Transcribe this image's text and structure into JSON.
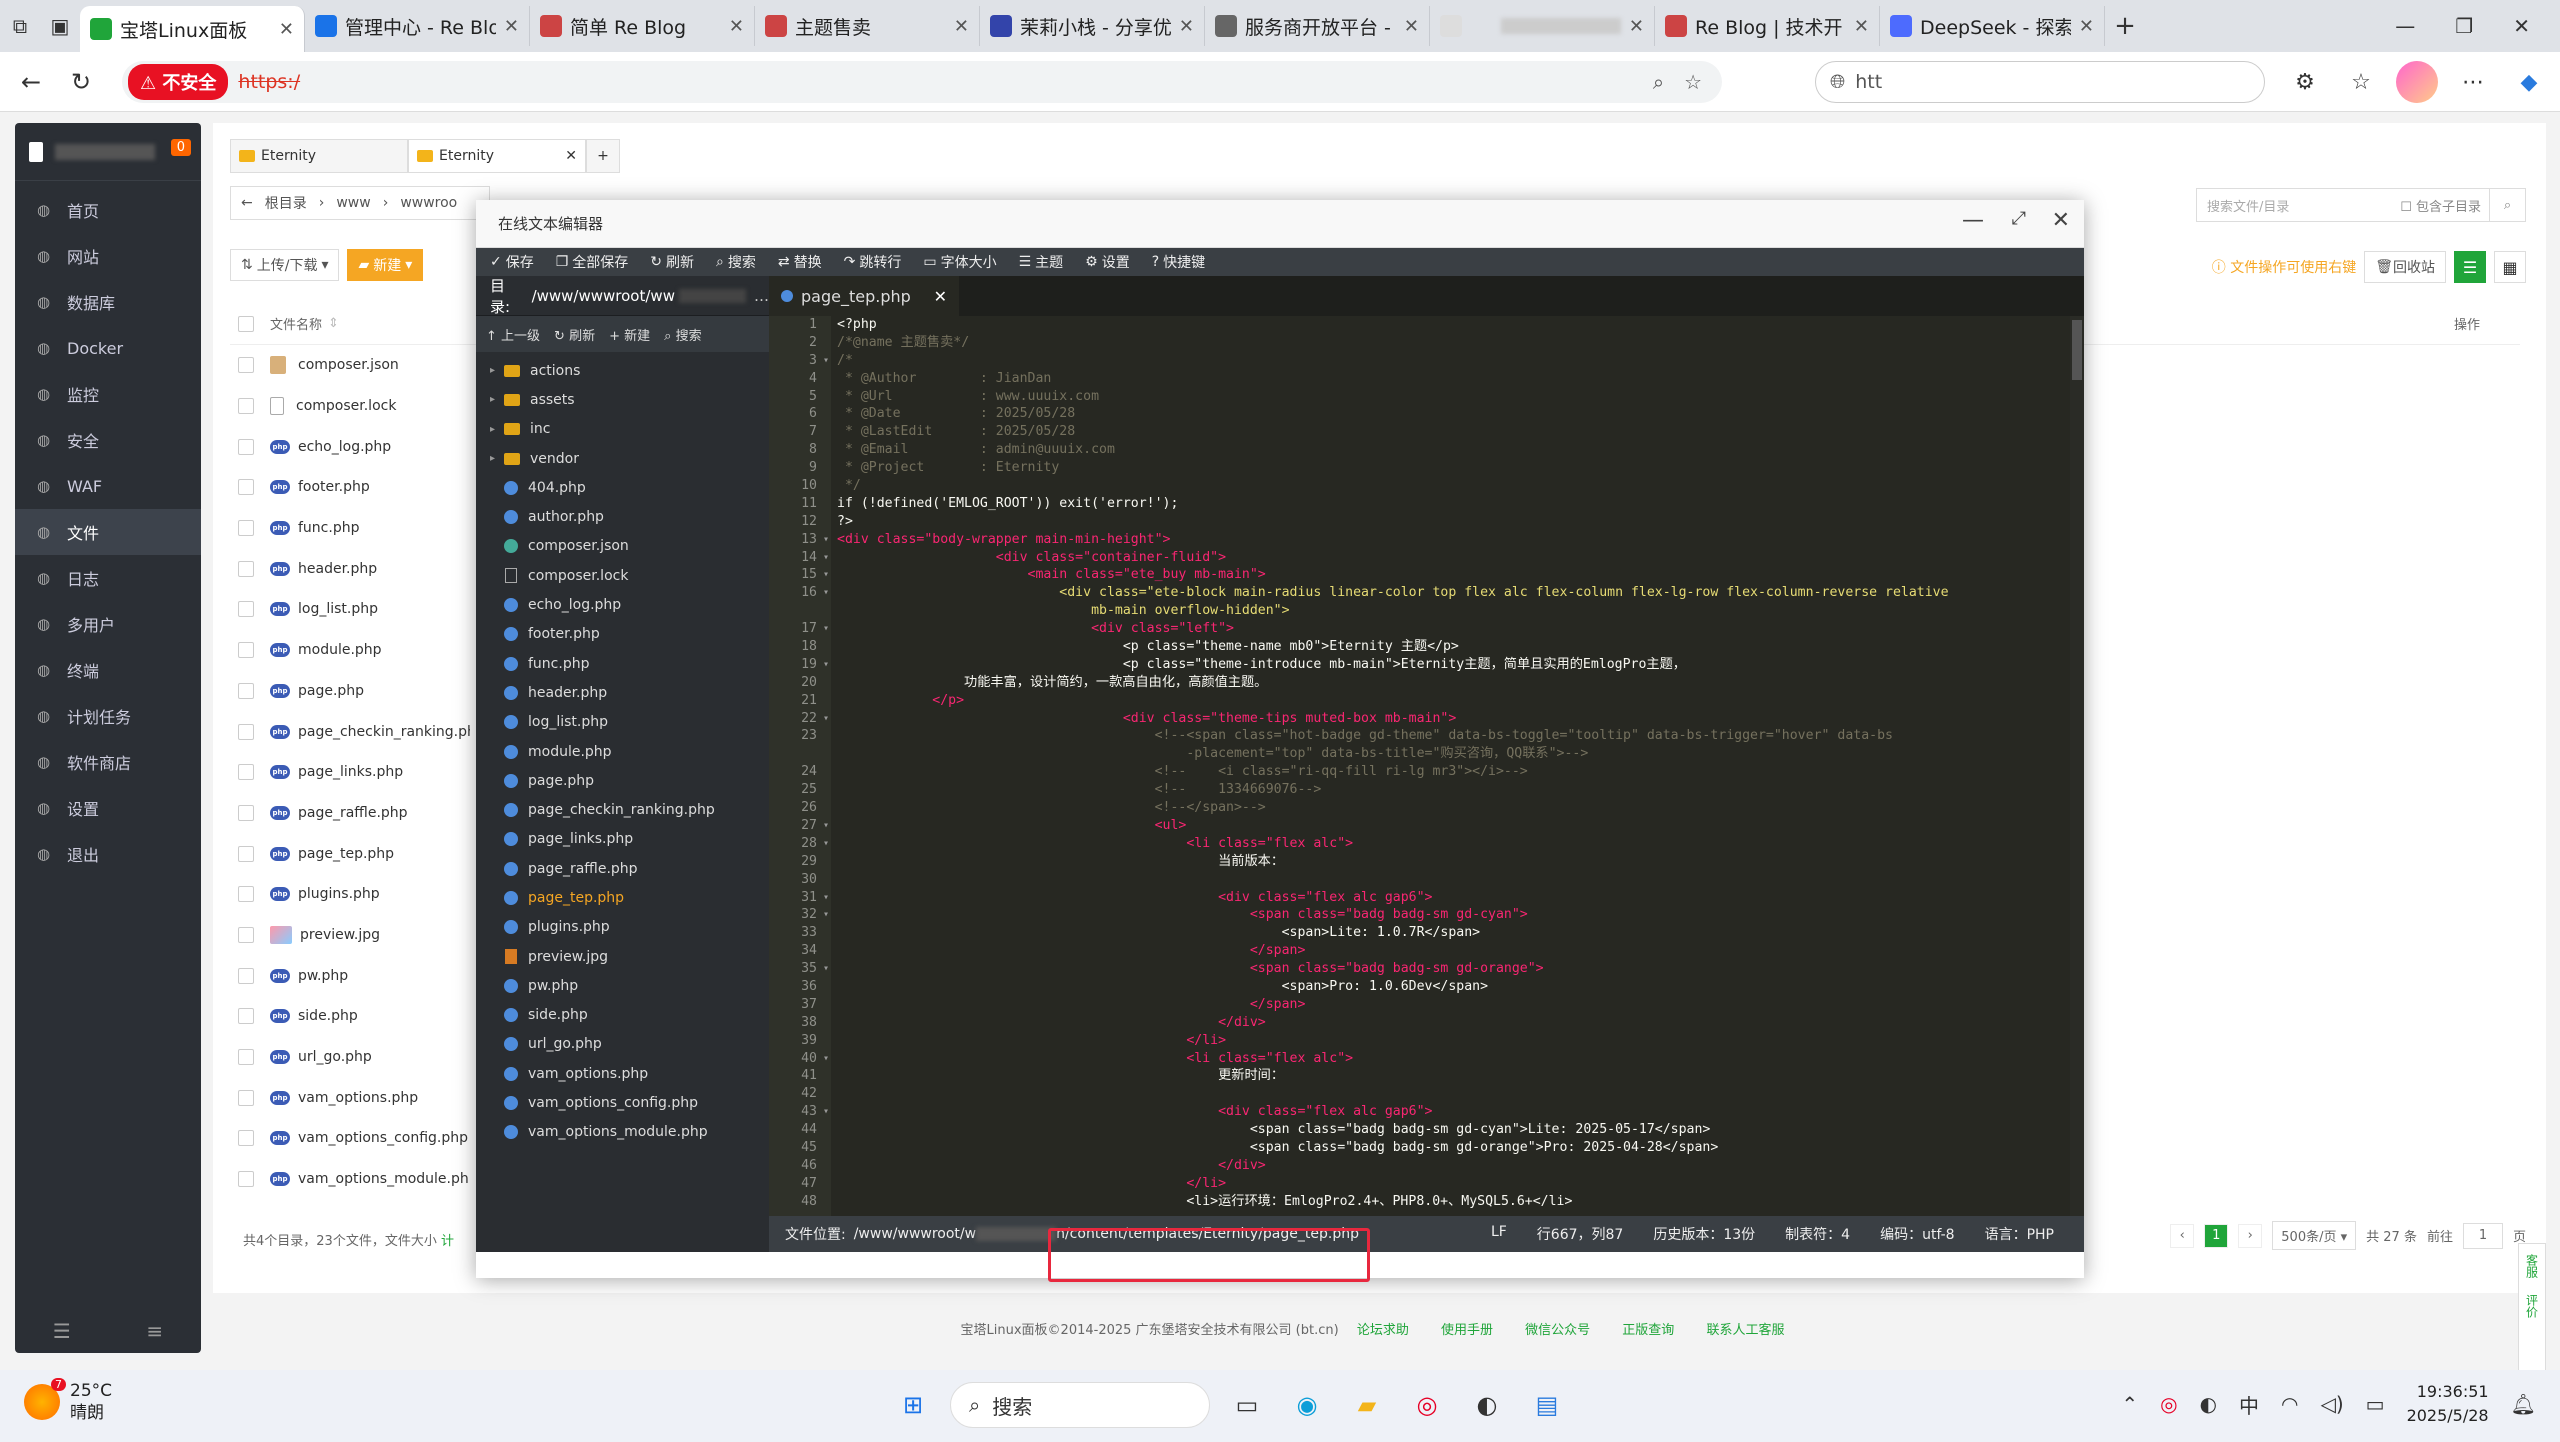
{
  "browser": {
    "tabs": [
      {
        "label": "宝塔Linux面板",
        "color": "#20a53a",
        "active": true
      },
      {
        "label": "管理中心 - Re Blo",
        "color": "#1a73e8"
      },
      {
        "label": "简单 Re Blog",
        "color": "#c44"
      },
      {
        "label": "主题售卖",
        "color": "#c44"
      },
      {
        "label": "茉莉小栈 - 分享优",
        "color": "#3344aa"
      },
      {
        "label": "服务商开放平台 -",
        "color": "#666"
      },
      {
        "label": "",
        "color": "#ddd"
      },
      {
        "label": "Re Blog | 技术开",
        "color": "#c44"
      },
      {
        "label": "DeepSeek - 探索",
        "color": "#4d6bfe"
      }
    ],
    "insecure_label": "不安全",
    "url": "https:/",
    "url2": "htt"
  },
  "sidebar": {
    "badge": "0",
    "items": [
      {
        "label": "首页",
        "icon": "home-icon"
      },
      {
        "label": "网站",
        "icon": "globe-icon"
      },
      {
        "label": "数据库",
        "icon": "database-icon"
      },
      {
        "label": "Docker",
        "icon": "docker-icon"
      },
      {
        "label": "监控",
        "icon": "monitor-icon"
      },
      {
        "label": "安全",
        "icon": "shield-icon"
      },
      {
        "label": "WAF",
        "icon": "waf-icon"
      },
      {
        "label": "文件",
        "icon": "folder-icon",
        "active": true
      },
      {
        "label": "日志",
        "icon": "log-icon"
      },
      {
        "label": "多用户",
        "icon": "users-icon"
      },
      {
        "label": "终端",
        "icon": "terminal-icon"
      },
      {
        "label": "计划任务",
        "icon": "clock-icon"
      },
      {
        "label": "软件商店",
        "icon": "store-icon"
      },
      {
        "label": "设置",
        "icon": "gear-icon"
      },
      {
        "label": "退出",
        "icon": "logout-icon"
      }
    ]
  },
  "files": {
    "tabs": [
      "Eternity",
      "Eternity"
    ],
    "breadcrumb": [
      "根目录",
      "www",
      "wwwroo"
    ],
    "toolbar": {
      "upload": "上传/下载",
      "new": "新建"
    },
    "search_placeholder": "搜索文件/目录",
    "include_sub": "包含子目录",
    "warn": "文件操作可使用右键",
    "recycle": "回收站",
    "col_name": "文件名称",
    "col_op": "操作",
    "rows": [
      {
        "name": "composer.json",
        "type": "json"
      },
      {
        "name": "composer.lock",
        "type": "doc"
      },
      {
        "name": "echo_log.php",
        "type": "php"
      },
      {
        "name": "footer.php",
        "type": "php"
      },
      {
        "name": "func.php",
        "type": "php"
      },
      {
        "name": "header.php",
        "type": "php"
      },
      {
        "name": "log_list.php",
        "type": "php"
      },
      {
        "name": "module.php",
        "type": "php"
      },
      {
        "name": "page.php",
        "type": "php"
      },
      {
        "name": "page_checkin_ranking.php",
        "type": "php"
      },
      {
        "name": "page_links.php",
        "type": "php"
      },
      {
        "name": "page_raffle.php",
        "type": "php"
      },
      {
        "name": "page_tep.php",
        "type": "php"
      },
      {
        "name": "plugins.php",
        "type": "php"
      },
      {
        "name": "preview.jpg",
        "type": "img"
      },
      {
        "name": "pw.php",
        "type": "php"
      },
      {
        "name": "side.php",
        "type": "php"
      },
      {
        "name": "url_go.php",
        "type": "php"
      },
      {
        "name": "vam_options.php",
        "type": "php"
      },
      {
        "name": "vam_options_config.php",
        "type": "php"
      },
      {
        "name": "vam_options_module.php",
        "type": "php"
      }
    ],
    "summary": "共4个目录，23个文件，文件大小",
    "summary_link": "计",
    "pager": {
      "current": "1",
      "per_page": "500条/页",
      "total": "共 27 条",
      "goto": "前往",
      "page_input": "1",
      "page_suffix": "页"
    }
  },
  "copyright": {
    "text": "宝塔Linux面板©2014-2025 广东堡塔安全技术有限公司 (bt.cn)",
    "links": [
      "论坛求助",
      "使用手册",
      "微信公众号",
      "正版查询",
      "联系人工客服"
    ]
  },
  "side_widget": {
    "a": "客服",
    "b": "评价"
  },
  "editor": {
    "title": "在线文本编辑器",
    "toolbar": [
      "保存",
      "全部保存",
      "刷新",
      "搜索",
      "替换",
      "跳转行",
      "字体大小",
      "主题",
      "设置",
      "快捷键"
    ],
    "dir_label": "目录:",
    "dir_path": "/www/wwwroot/ww",
    "tree_buttons": [
      "上一级",
      "刷新",
      "新建",
      "搜索"
    ],
    "tree": [
      {
        "name": "actions",
        "type": "dir"
      },
      {
        "name": "assets",
        "type": "dir"
      },
      {
        "name": "inc",
        "type": "dir"
      },
      {
        "name": "vendor",
        "type": "dir"
      },
      {
        "name": "404.php",
        "type": "php"
      },
      {
        "name": "author.php",
        "type": "php"
      },
      {
        "name": "composer.json",
        "type": "json"
      },
      {
        "name": "composer.lock",
        "type": "doc"
      },
      {
        "name": "echo_log.php",
        "type": "php"
      },
      {
        "name": "footer.php",
        "type": "php"
      },
      {
        "name": "func.php",
        "type": "php"
      },
      {
        "name": "header.php",
        "type": "php"
      },
      {
        "name": "log_list.php",
        "type": "php"
      },
      {
        "name": "module.php",
        "type": "php"
      },
      {
        "name": "page.php",
        "type": "php"
      },
      {
        "name": "page_checkin_ranking.php",
        "type": "php"
      },
      {
        "name": "page_links.php",
        "type": "php"
      },
      {
        "name": "page_raffle.php",
        "type": "php"
      },
      {
        "name": "page_tep.php",
        "type": "php",
        "active": true
      },
      {
        "name": "plugins.php",
        "type": "php"
      },
      {
        "name": "preview.jpg",
        "type": "img"
      },
      {
        "name": "pw.php",
        "type": "php"
      },
      {
        "name": "side.php",
        "type": "php"
      },
      {
        "name": "url_go.php",
        "type": "php"
      },
      {
        "name": "vam_options.php",
        "type": "php"
      },
      {
        "name": "vam_options_config.php",
        "type": "php"
      },
      {
        "name": "vam_options_module.php",
        "type": "php"
      }
    ],
    "open_tab": "page_tep.php",
    "code_lines": [
      {
        "n": "1",
        "t": "<?php",
        "c": "#f8f8f2"
      },
      {
        "n": "2",
        "t": "/*@name 主题售卖*/",
        "c": "#75715e"
      },
      {
        "n": "3",
        "t": "/*",
        "c": "#75715e",
        "f": 1
      },
      {
        "n": "4",
        "t": " * @Author        : JianDan",
        "c": "#75715e"
      },
      {
        "n": "5",
        "t": " * @Url           : www.uuuix.com",
        "c": "#75715e"
      },
      {
        "n": "6",
        "t": " * @Date          : 2025/05/28",
        "c": "#75715e"
      },
      {
        "n": "7",
        "t": " * @LastEdit      : 2025/05/28",
        "c": "#75715e"
      },
      {
        "n": "8",
        "t": " * @Email         : admin@uuuix.com",
        "c": "#75715e"
      },
      {
        "n": "9",
        "t": " * @Project       : Eternity",
        "c": "#75715e"
      },
      {
        "n": "10",
        "t": " */",
        "c": "#75715e"
      },
      {
        "n": "11",
        "t": "if (!defined('EMLOG_ROOT')) exit('error!');",
        "c": "#f8f8f2"
      },
      {
        "n": "12",
        "t": "?>",
        "c": "#f8f8f2"
      },
      {
        "n": "13",
        "t": "<div class=\"body-wrapper main-min-height\">",
        "c": "#f92672",
        "f": 1
      },
      {
        "n": "14",
        "t": "                    <div class=\"container-fluid\">",
        "c": "#f92672",
        "f": 1
      },
      {
        "n": "15",
        "t": "                        <main class=\"ete_buy mb-main\">",
        "c": "#f92672",
        "f": 1
      },
      {
        "n": "16",
        "t": "                            <div class=\"ete-block main-radius linear-color top flex alc flex-column flex-lg-row flex-column-reverse relative",
        "c": "#e6db74",
        "f": 1
      },
      {
        "n": "",
        "t": "                                mb-main overflow-hidden\">",
        "c": "#e6db74"
      },
      {
        "n": "17",
        "t": "                                <div class=\"left\">",
        "c": "#f92672",
        "f": 1
      },
      {
        "n": "18",
        "t": "                                    <p class=\"theme-name mb0\">Eternity 主题</p>",
        "c": "#f8f8f2"
      },
      {
        "n": "19",
        "t": "                                    <p class=\"theme-introduce mb-main\">Eternity主题，简单且实用的EmlogPro主题，",
        "c": "#f8f8f2",
        "f": 1
      },
      {
        "n": "20",
        "t": "                功能丰富，设计简约，一款高自由化，高颜值主题。",
        "c": "#f8f8f2"
      },
      {
        "n": "21",
        "t": "            </p>",
        "c": "#f92672"
      },
      {
        "n": "22",
        "t": "                                    <div class=\"theme-tips muted-box mb-main\">",
        "c": "#f92672",
        "f": 1
      },
      {
        "n": "23",
        "t": "                                        <!--<span class=\"hot-badge gd-theme\" data-bs-toggle=\"tooltip\" data-bs-trigger=\"hover\" data-bs",
        "c": "#75715e"
      },
      {
        "n": "",
        "t": "                                            -placement=\"top\" data-bs-title=\"购买咨询，QQ联系\">-->",
        "c": "#75715e"
      },
      {
        "n": "24",
        "t": "                                        <!--    <i class=\"ri-qq-fill ri-lg mr3\"></i>-->",
        "c": "#75715e"
      },
      {
        "n": "25",
        "t": "                                        <!--    1334669076-->",
        "c": "#75715e"
      },
      {
        "n": "26",
        "t": "                                        <!--</span>-->",
        "c": "#75715e"
      },
      {
        "n": "27",
        "t": "                                        <ul>",
        "c": "#f92672",
        "f": 1
      },
      {
        "n": "28",
        "t": "                                            <li class=\"flex alc\">",
        "c": "#f92672",
        "f": 1
      },
      {
        "n": "29",
        "t": "                                                当前版本：",
        "c": "#f8f8f2"
      },
      {
        "n": "30",
        "t": "",
        "c": "#f8f8f2"
      },
      {
        "n": "31",
        "t": "                                                <div class=\"flex alc gap6\">",
        "c": "#f92672",
        "f": 1
      },
      {
        "n": "32",
        "t": "                                                    <span class=\"badg badg-sm gd-cyan\">",
        "c": "#f92672",
        "f": 1
      },
      {
        "n": "33",
        "t": "                                                        <span>Lite: 1.0.7R</span>",
        "c": "#f8f8f2"
      },
      {
        "n": "34",
        "t": "                                                    </span>",
        "c": "#f92672"
      },
      {
        "n": "35",
        "t": "                                                    <span class=\"badg badg-sm gd-orange\">",
        "c": "#f92672",
        "f": 1
      },
      {
        "n": "36",
        "t": "                                                        <span>Pro: 1.0.6Dev</span>",
        "c": "#f8f8f2"
      },
      {
        "n": "37",
        "t": "                                                    </span>",
        "c": "#f92672"
      },
      {
        "n": "38",
        "t": "                                                </div>",
        "c": "#f92672"
      },
      {
        "n": "39",
        "t": "                                            </li>",
        "c": "#f92672"
      },
      {
        "n": "40",
        "t": "                                            <li class=\"flex alc\">",
        "c": "#f92672",
        "f": 1
      },
      {
        "n": "41",
        "t": "                                                更新时间：",
        "c": "#f8f8f2"
      },
      {
        "n": "42",
        "t": "",
        "c": "#f8f8f2"
      },
      {
        "n": "43",
        "t": "                                                <div class=\"flex alc gap6\">",
        "c": "#f92672",
        "f": 1
      },
      {
        "n": "44",
        "t": "                                                    <span class=\"badg badg-sm gd-cyan\">Lite: 2025-05-17</span>",
        "c": "#f8f8f2"
      },
      {
        "n": "45",
        "t": "                                                    <span class=\"badg badg-sm gd-orange\">Pro: 2025-04-28</span>",
        "c": "#f8f8f2"
      },
      {
        "n": "46",
        "t": "                                                </div>",
        "c": "#f92672"
      },
      {
        "n": "47",
        "t": "                                            </li>",
        "c": "#f92672"
      },
      {
        "n": "48",
        "t": "                                            <li>运行环境：EmlogPro2.4+、PHP8.0+、MySQL5.6+</li>",
        "c": "#f8f8f2"
      }
    ],
    "status": {
      "file_label": "文件位置:",
      "path_a": "/www/wwwroot/w",
      "path_b": "n/content/templates/Eternity/page_tep.php",
      "eol": "LF",
      "pos": "行667，列87",
      "history": "历史版本：13份",
      "tab": "制表符：4",
      "encoding": "编码：utf-8",
      "lang": "语言：PHP"
    }
  },
  "taskbar": {
    "temp": "25°C",
    "weather": "晴朗",
    "weather_badge": "7",
    "search": "搜索",
    "ime": "中",
    "time": "19:36:51",
    "date": "2025/5/28"
  }
}
